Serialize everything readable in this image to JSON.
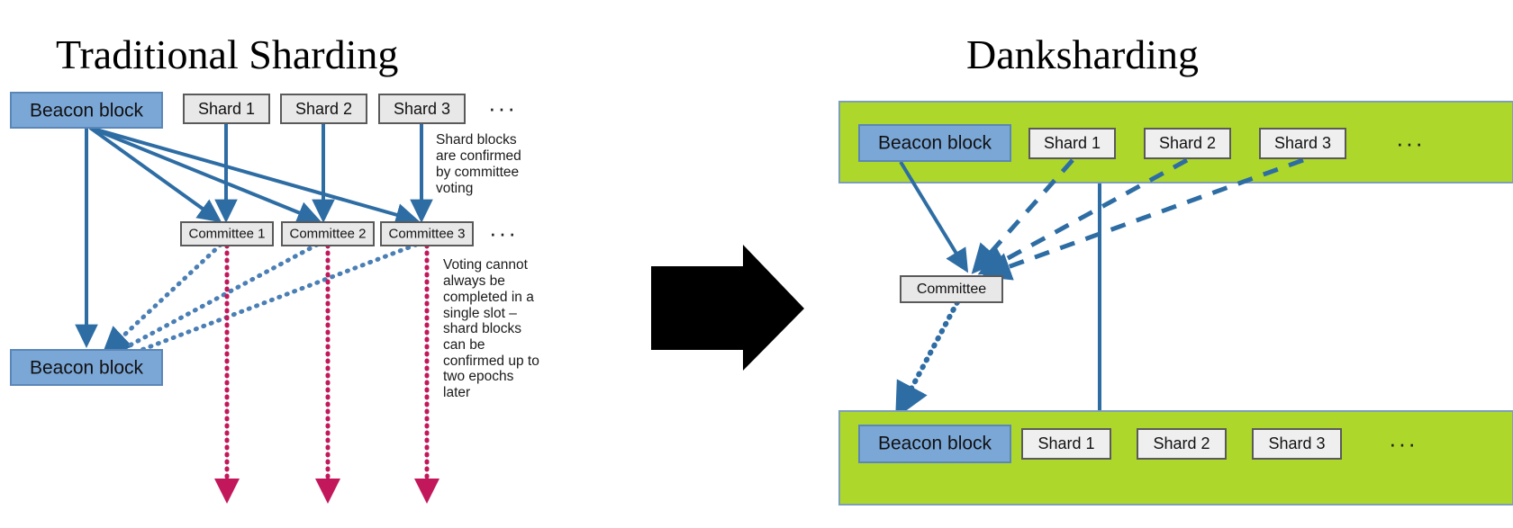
{
  "panels": {
    "left": {
      "title": "Traditional Sharding",
      "top_row": {
        "beacon_label": "Beacon block",
        "shards": [
          "Shard 1",
          "Shard 2",
          "Shard 3"
        ],
        "ellipsis": "···"
      },
      "committees": [
        "Committee 1",
        "Committee 2",
        "Committee 3"
      ],
      "committees_ellipsis": "···",
      "bottom_beacon_label": "Beacon block",
      "annotation_top": [
        "Shard blocks",
        "are confirmed",
        "by committee",
        "voting"
      ],
      "annotation_bottom": [
        "Voting cannot",
        "always be",
        "completed in a",
        "single slot –",
        "shard blocks",
        "can be",
        "confirmed up to",
        "two epochs",
        "later"
      ]
    },
    "right": {
      "title": "Danksharding",
      "top_band": {
        "beacon_label": "Beacon block",
        "shards": [
          "Shard 1",
          "Shard 2",
          "Shard 3"
        ],
        "ellipsis": "···"
      },
      "committee_label": "Committee",
      "bottom_band": {
        "beacon_label": "Beacon block",
        "shards": [
          "Shard 1",
          "Shard 2",
          "Shard 3"
        ],
        "ellipsis": "···"
      }
    }
  },
  "transition_arrow": "right-arrow",
  "colors": {
    "beacon_fill": "#7BA7D7",
    "beacon_stroke": "#5B87B8",
    "grey_box_fill": "#E8E8E8",
    "grey_box_stroke": "#5A5A5A",
    "band_green": "#ADD82B",
    "band_green_stroke": "#7E9EB8",
    "blue_line": "#2E6DA4",
    "crimson_dotted": "#C2185B",
    "arrow_black": "#000000",
    "title_text": "#000000"
  }
}
